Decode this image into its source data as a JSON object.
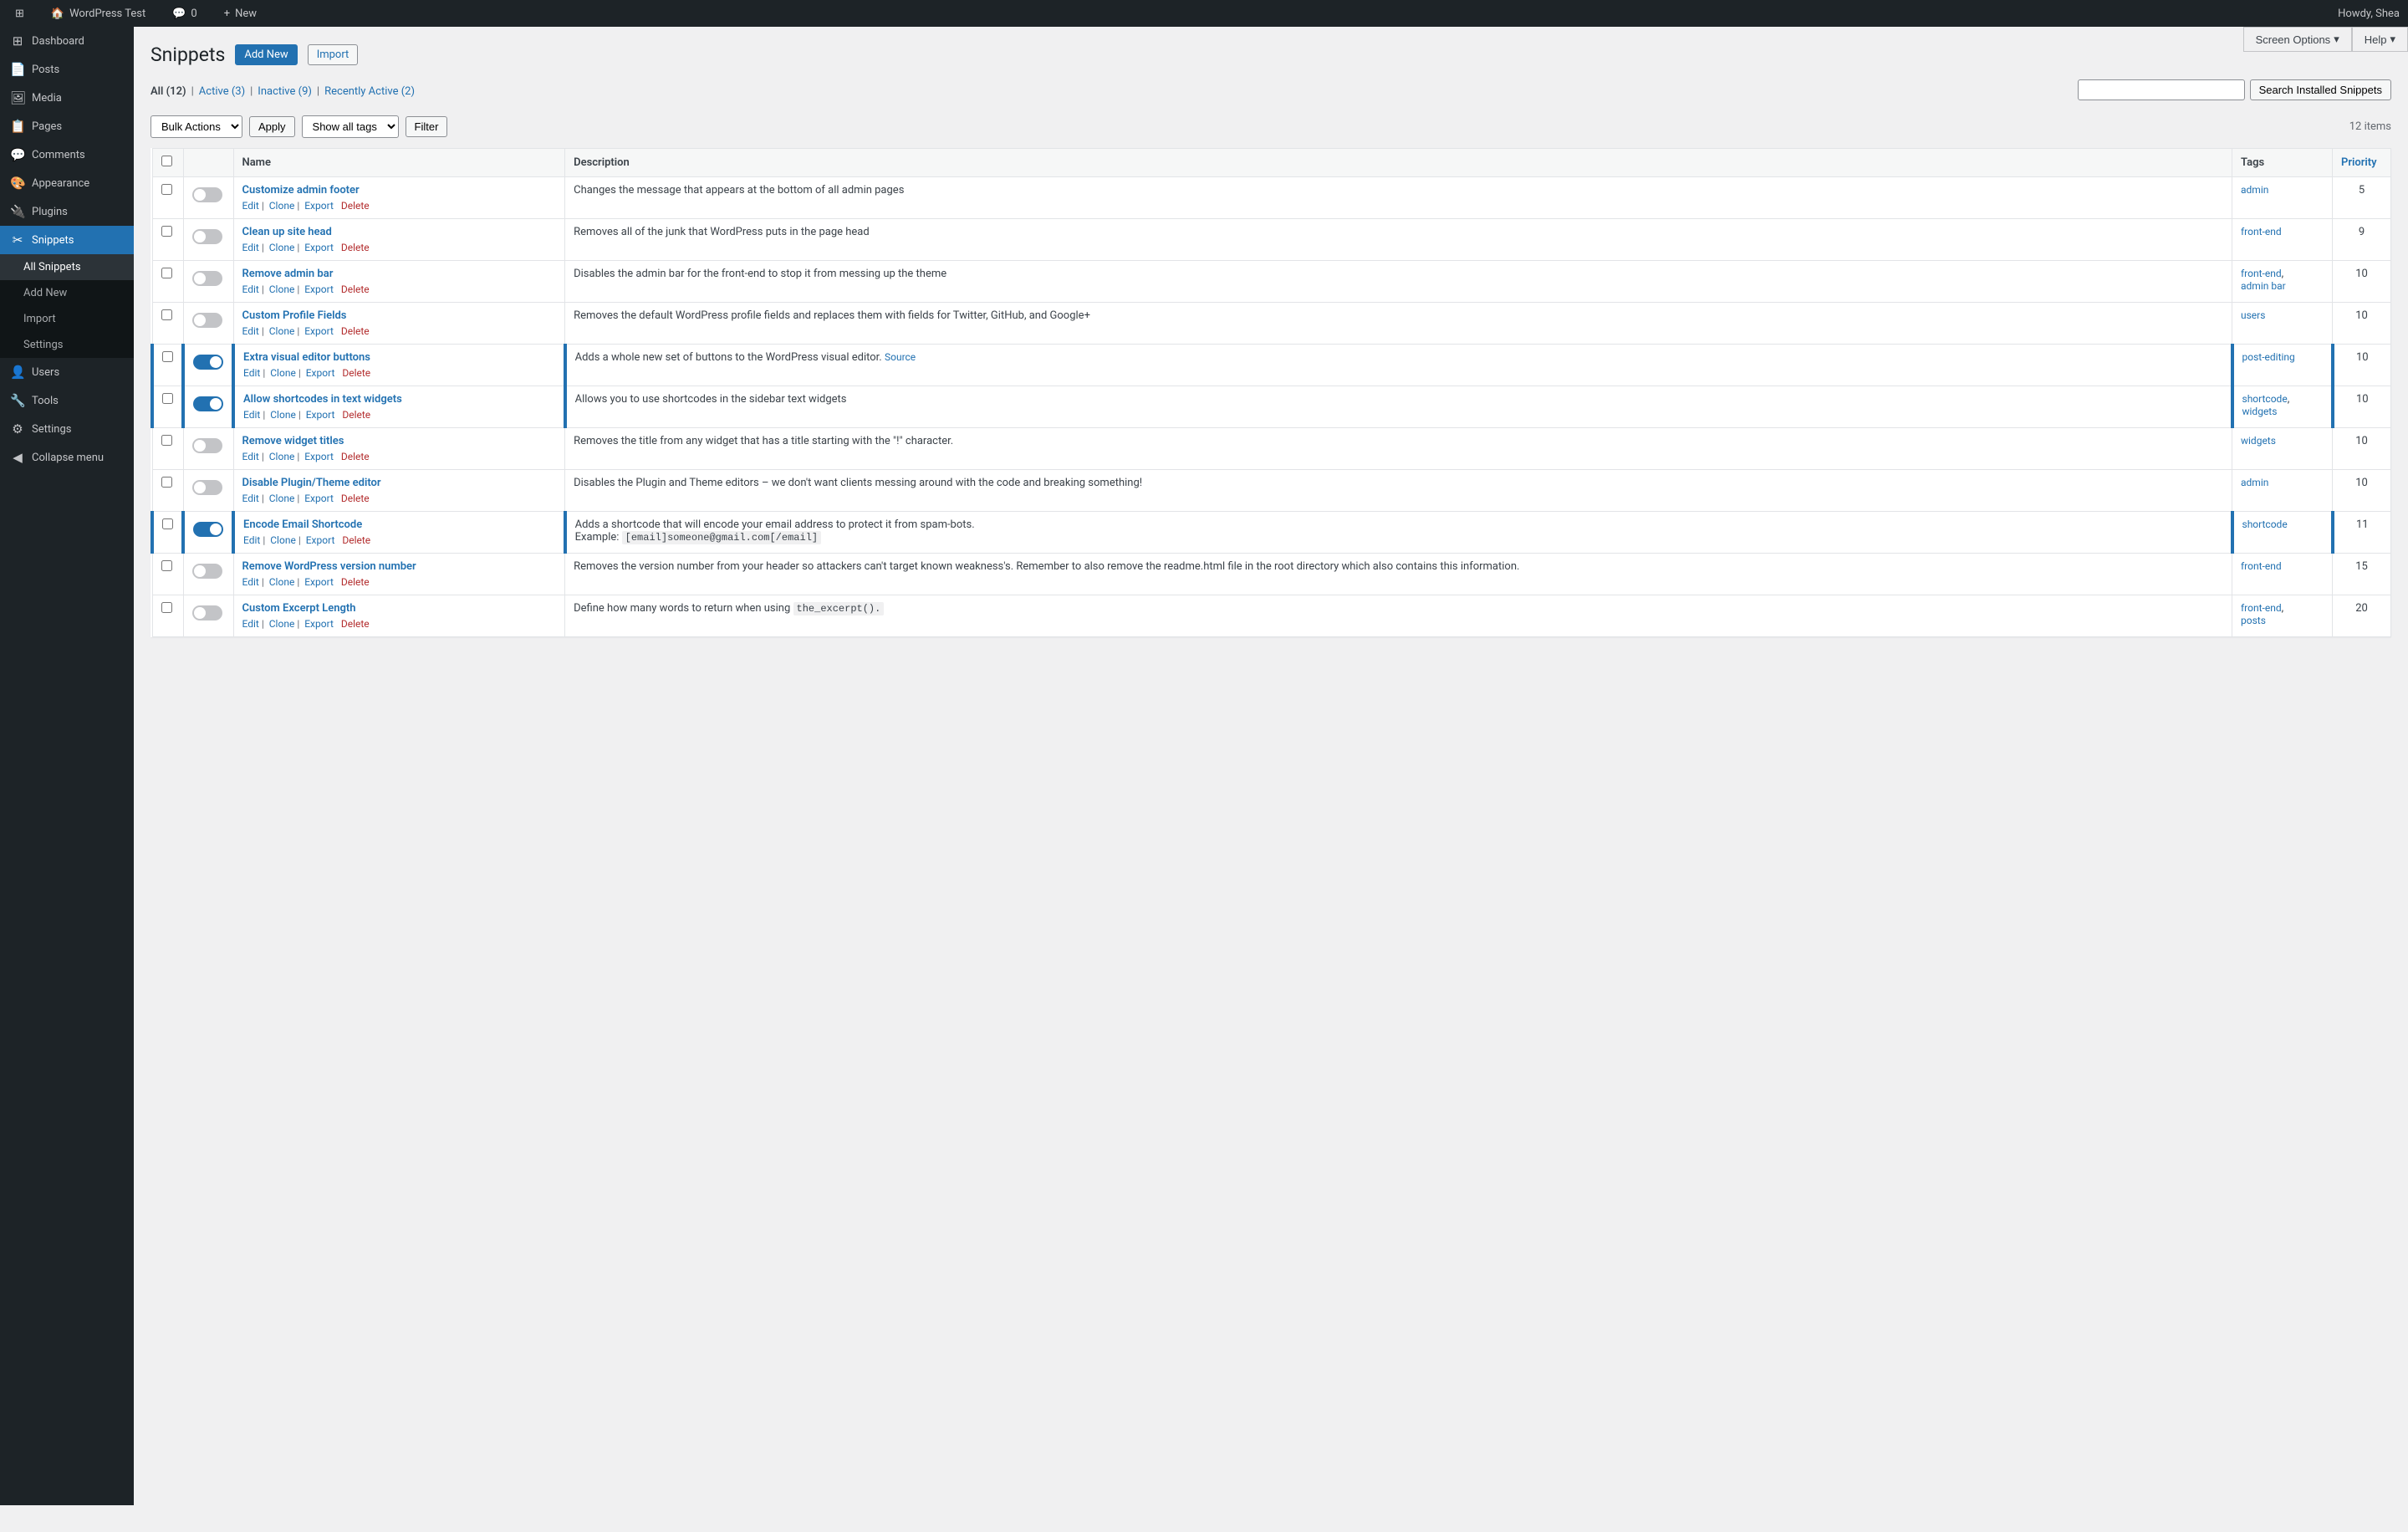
{
  "adminBar": {
    "logo": "⊞",
    "site": "WordPress Test",
    "comments_icon": "💬",
    "comments_count": "0",
    "new_label": "New",
    "howdy": "Howdy, Shea"
  },
  "topButtons": [
    {
      "label": "Screen Options",
      "chevron": "▾"
    },
    {
      "label": "Help",
      "chevron": "▾"
    }
  ],
  "sidebar": {
    "items": [
      {
        "id": "dashboard",
        "icon": "⊞",
        "label": "Dashboard"
      },
      {
        "id": "posts",
        "icon": "📄",
        "label": "Posts"
      },
      {
        "id": "media",
        "icon": "🖼",
        "label": "Media"
      },
      {
        "id": "pages",
        "icon": "📋",
        "label": "Pages"
      },
      {
        "id": "comments",
        "icon": "💬",
        "label": "Comments"
      },
      {
        "id": "appearance",
        "icon": "🎨",
        "label": "Appearance"
      },
      {
        "id": "plugins",
        "icon": "🔌",
        "label": "Plugins"
      },
      {
        "id": "snippets",
        "icon": "✂",
        "label": "Snippets",
        "active": true
      },
      {
        "id": "users",
        "icon": "👤",
        "label": "Users"
      },
      {
        "id": "tools",
        "icon": "🔧",
        "label": "Tools"
      },
      {
        "id": "settings",
        "icon": "⚙",
        "label": "Settings"
      },
      {
        "id": "collapse",
        "icon": "◀",
        "label": "Collapse menu"
      }
    ],
    "snippetsSubmenu": [
      {
        "id": "all-snippets",
        "label": "All Snippets",
        "active": true
      },
      {
        "id": "add-new",
        "label": "Add New"
      },
      {
        "id": "import",
        "label": "Import"
      },
      {
        "id": "settings",
        "label": "Settings"
      }
    ]
  },
  "page": {
    "title": "Snippets",
    "addNew": "Add New",
    "import": "Import"
  },
  "filterLinks": [
    {
      "id": "all",
      "label": "All",
      "count": "12",
      "active": true
    },
    {
      "id": "active",
      "label": "Active",
      "count": "3"
    },
    {
      "id": "inactive",
      "label": "Inactive",
      "count": "9"
    },
    {
      "id": "recently-active",
      "label": "Recently Active",
      "count": "2"
    }
  ],
  "toolbar": {
    "bulkActions": "Bulk Actions",
    "apply": "Apply",
    "showAllTags": "Show all tags",
    "filter": "Filter",
    "itemsCount": "12 items",
    "searchPlaceholder": "",
    "searchBtn": "Search Installed Snippets"
  },
  "tableHeaders": {
    "name": "Name",
    "description": "Description",
    "tags": "Tags",
    "priority": "Priority"
  },
  "snippets": [
    {
      "id": 1,
      "name": "Customize admin footer",
      "active": false,
      "description": "Changes the message that appears at the bottom of all admin pages",
      "tags": [
        "admin"
      ],
      "priority": "5",
      "activeRow": false
    },
    {
      "id": 2,
      "name": "Clean up site head",
      "active": false,
      "description": "Removes all of the junk that WordPress puts in the page head",
      "tags": [
        "front-end"
      ],
      "priority": "9",
      "activeRow": false
    },
    {
      "id": 3,
      "name": "Remove admin bar",
      "active": false,
      "description": "Disables the admin bar for the front-end to stop it from messing up the theme",
      "tags": [
        "front-end",
        "admin bar"
      ],
      "priority": "10",
      "activeRow": false
    },
    {
      "id": 4,
      "name": "Custom Profile Fields",
      "active": false,
      "description": "Removes the default WordPress profile fields and replaces them with fields for Twitter, GitHub, and Google+",
      "tags": [
        "users"
      ],
      "priority": "10",
      "activeRow": false
    },
    {
      "id": 5,
      "name": "Extra visual editor buttons",
      "active": true,
      "description": "Adds a whole new set of buttons to the WordPress visual editor.",
      "descriptionSource": "Source",
      "tags": [
        "post-editing"
      ],
      "priority": "10",
      "activeRow": true
    },
    {
      "id": 6,
      "name": "Allow shortcodes in text widgets",
      "active": true,
      "description": "Allows you to use shortcodes in the sidebar text widgets",
      "tags": [
        "shortcode",
        "widgets"
      ],
      "priority": "10",
      "activeRow": true
    },
    {
      "id": 7,
      "name": "Remove widget titles",
      "active": false,
      "description": "Removes the title from any widget that has a title starting with the \"!\" character.",
      "tags": [
        "widgets"
      ],
      "priority": "10",
      "activeRow": false
    },
    {
      "id": 8,
      "name": "Disable Plugin/Theme editor",
      "active": false,
      "description": "Disables the Plugin and Theme editors – we don't want clients messing around with the code and breaking something!",
      "tags": [
        "admin"
      ],
      "priority": "10",
      "activeRow": false
    },
    {
      "id": 9,
      "name": "Encode Email Shortcode",
      "active": true,
      "description": "Adds a shortcode that will encode your email address to protect it from spam-bots.",
      "descriptionExtra": "Example:",
      "descriptionCode": "[email]someone@gmail.com[/email]",
      "tags": [
        "shortcode"
      ],
      "priority": "11",
      "activeRow": true
    },
    {
      "id": 10,
      "name": "Remove WordPress version number",
      "active": false,
      "description": "Removes the version number from your header so attackers can't target known weakness's. Remember to also remove the readme.html file in the root directory which also contains this information.",
      "tags": [
        "front-end"
      ],
      "priority": "15",
      "activeRow": false
    },
    {
      "id": 11,
      "name": "Custom Excerpt Length",
      "active": false,
      "description": "Define how many words to return when using",
      "descriptionCode": "the_excerpt().",
      "tags": [
        "front-end",
        "posts"
      ],
      "priority": "20",
      "activeRow": false
    }
  ]
}
